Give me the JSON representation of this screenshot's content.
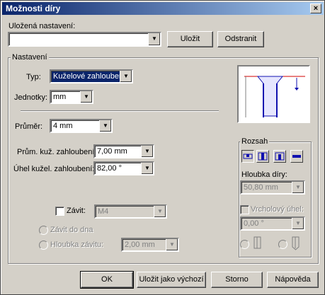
{
  "window": {
    "title": "Možnosti díry",
    "close_label": "×"
  },
  "saved": {
    "label": "Uložená nastavení:",
    "value": "",
    "save_button": "Uložit",
    "remove_button": "Odstranit"
  },
  "settings": {
    "group_label": "Nastavení",
    "type_label": "Typ:",
    "type_value": "Kuželové zahloubeni",
    "units_label": "Jednotky:",
    "units_value": "mm",
    "diameter_label": "Průměr:",
    "diameter_value": "4 mm",
    "countersink_diameter_label": "Prům. kuž. zahloubení:",
    "countersink_diameter_value": "7,00 mm",
    "countersink_angle_label": "Úhel kužel. zahloubení:",
    "countersink_angle_value": "82,00 °",
    "thread_label": "Závit:",
    "thread_value": "M4",
    "thread_to_bottom_label": "Závit do dna",
    "thread_depth_label": "Hloubka závitu:",
    "thread_depth_value": "2,00 mm"
  },
  "range": {
    "group_label": "Rozsah",
    "depth_label": "Hloubka díry:",
    "depth_value": "50,80 mm",
    "tip_angle_label": "Vrcholový úhel:",
    "tip_angle_value": "0,00 °"
  },
  "footer": {
    "ok": "OK",
    "save_default": "Uložit jako výchozí",
    "cancel": "Storno",
    "help": "Nápověda"
  },
  "colors": {
    "title_start": "#0a246a",
    "title_end": "#a6caf0",
    "preview_red": "#d00000",
    "preview_blue": "#1010b0"
  }
}
